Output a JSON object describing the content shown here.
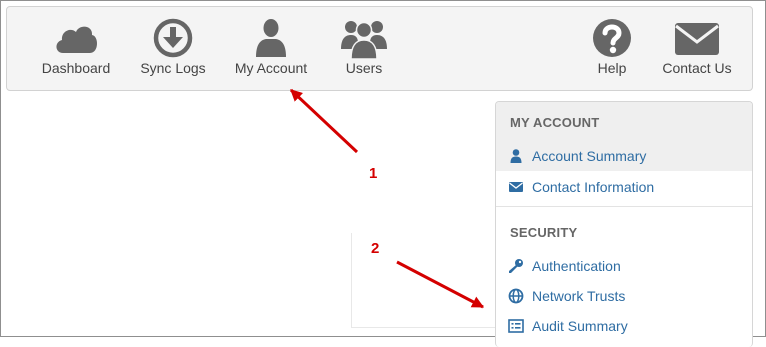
{
  "nav": {
    "items": [
      {
        "label": "Dashboard",
        "icon": "cloud-icon"
      },
      {
        "label": "Sync Logs",
        "icon": "download-icon"
      },
      {
        "label": "My Account",
        "icon": "user-icon"
      },
      {
        "label": "Users",
        "icon": "users-icon"
      },
      {
        "label": "Help",
        "icon": "help-icon"
      },
      {
        "label": "Contact Us",
        "icon": "envelope-icon"
      }
    ]
  },
  "sidebar": {
    "my_account_heading": "MY ACCOUNT",
    "account_summary": "Account Summary",
    "contact_information": "Contact Information",
    "security_heading": "SECURITY",
    "authentication": "Authentication",
    "network_trusts": "Network Trusts",
    "audit_summary": "Audit Summary"
  },
  "annotations": {
    "marker1": "1",
    "marker2": "2"
  },
  "colors": {
    "icon_gray": "#666666",
    "link_blue": "#2f6da3",
    "arrow_red": "#d40000"
  }
}
